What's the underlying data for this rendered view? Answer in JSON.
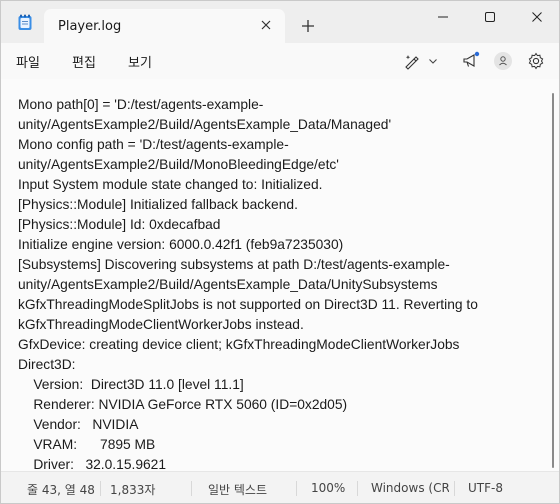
{
  "tab": {
    "title": "Player.log"
  },
  "menu": {
    "file": "파일",
    "edit": "편집",
    "view": "보기"
  },
  "editor_lines": [
    "Mono path[0] = 'D:/test/agents-example-",
    "unity/AgentsExample2/Build/AgentsExample_Data/Managed'",
    "Mono config path = 'D:/test/agents-example-",
    "unity/AgentsExample2/Build/MonoBleedingEdge/etc'",
    "Input System module state changed to: Initialized.",
    "[Physics::Module] Initialized fallback backend.",
    "[Physics::Module] Id: 0xdecafbad",
    "Initialize engine version: 6000.0.42f1 (feb9a7235030)",
    "[Subsystems] Discovering subsystems at path D:/test/agents-example-",
    "unity/AgentsExample2/Build/AgentsExample_Data/UnitySubsystems",
    "kGfxThreadingModeSplitJobs is not supported on Direct3D 11. Reverting to",
    "kGfxThreadingModeClientWorkerJobs instead.",
    "GfxDevice: creating device client; kGfxThreadingModeClientWorkerJobs",
    "Direct3D:",
    "    Version:  Direct3D 11.0 [level 11.1]",
    "    Renderer: NVIDIA GeForce RTX 5060 (ID=0x2d05)",
    "    Vendor:   NVIDIA",
    "    VRAM:      7895 MB",
    "    Driver:   32.0.15.9621"
  ],
  "status": {
    "position": "줄 43, 열 48",
    "chars": "1,833자",
    "format": "일반 텍스트",
    "zoom": "100%",
    "line_ending": "Windows (CRL",
    "encoding": "UTF-8"
  },
  "colors": {
    "accent": "#1a73e8",
    "notify_dot": "#2b6bd6"
  },
  "icons": [
    "notepad-icon",
    "close-icon",
    "plus-icon",
    "minimize-icon",
    "maximize-icon",
    "close-window-icon",
    "copilot-pen-icon",
    "chevron-down-icon",
    "megaphone-icon",
    "account-icon",
    "settings-icon"
  ]
}
